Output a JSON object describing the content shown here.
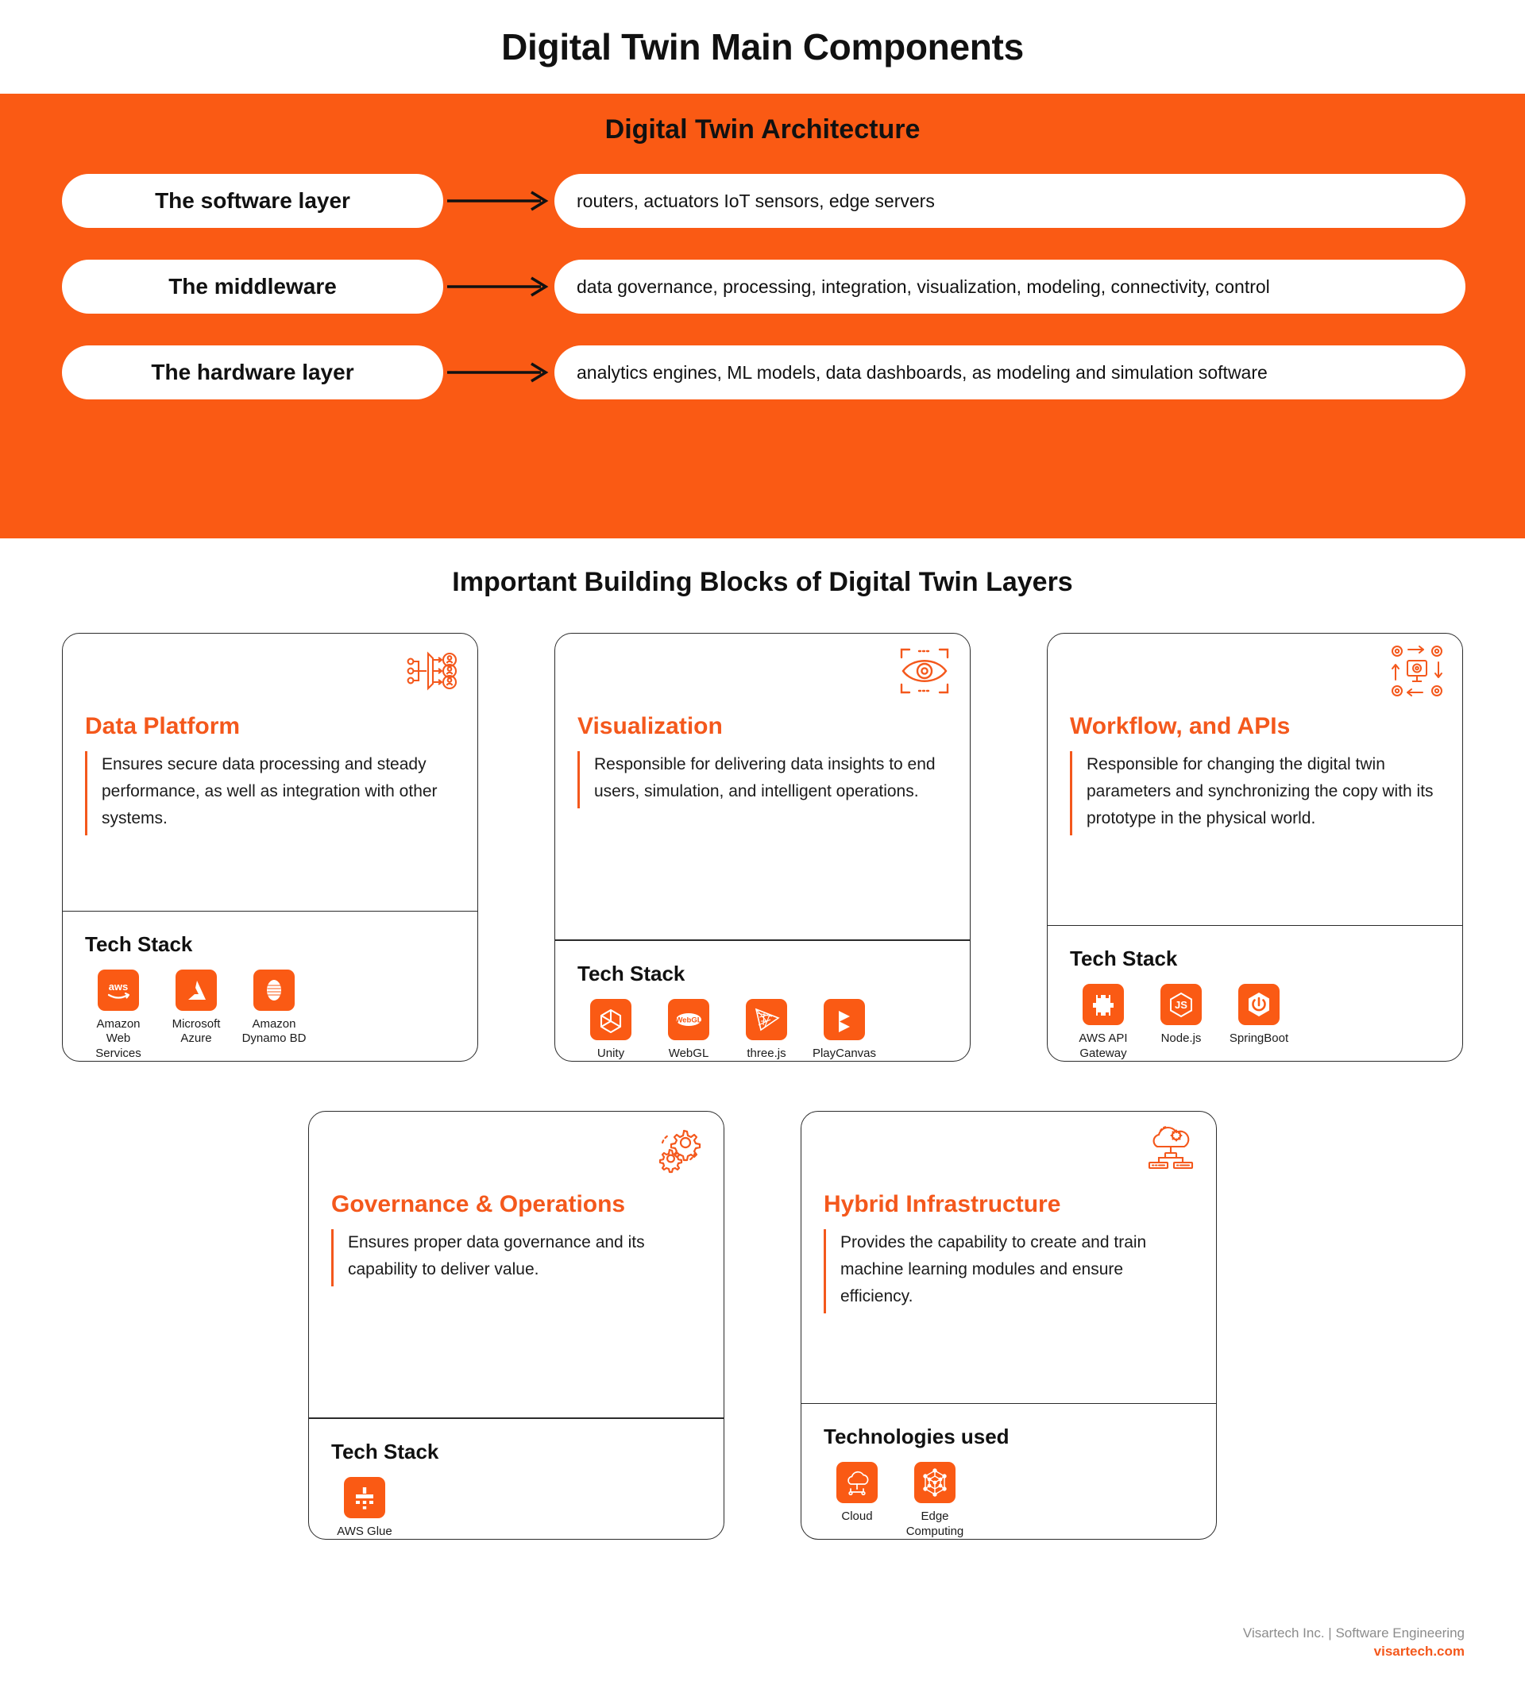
{
  "page_title": "Digital Twin Main Components",
  "architecture": {
    "title": "Digital Twin Architecture",
    "accent_color": "#FA5A14",
    "rows": [
      {
        "layer": "The software layer",
        "details": "routers, actuators IoT sensors, edge servers"
      },
      {
        "layer": "The middleware",
        "details": "data governance, processing, integration, visualization, modeling, connectivity, control"
      },
      {
        "layer": "The hardware layer",
        "details": "analytics engines, ML models, data dashboards, as modeling and simulation software"
      }
    ]
  },
  "blocks": {
    "title": "Important Building Blocks of Digital Twin Layers",
    "heading_color": "#F4581C",
    "cards": [
      {
        "icon": "data-distribution-icon",
        "heading": "Data Platform",
        "description": "Ensures secure data processing and steady performance, as well as integration with other systems.",
        "stack_title": "Tech Stack",
        "stack": [
          {
            "icon": "aws-icon",
            "label": "Amazon\nWeb Services"
          },
          {
            "icon": "azure-icon",
            "label": "Microsoft\nAzure"
          },
          {
            "icon": "dynamodb-icon",
            "label": "Amazon\nDynamo BD"
          }
        ]
      },
      {
        "icon": "eye-scan-icon",
        "heading": "Visualization",
        "description": "Responsible for delivering data insights to end users, simulation, and intelligent operations.",
        "stack_title": "Tech Stack",
        "stack": [
          {
            "icon": "unity-icon",
            "label": "Unity"
          },
          {
            "icon": "webgl-icon",
            "label": "WebGL"
          },
          {
            "icon": "threejs-icon",
            "label": "three.js"
          },
          {
            "icon": "playcanvas-icon",
            "label": "PlayCanvas"
          }
        ]
      },
      {
        "icon": "workflow-gears-icon",
        "heading": "Workflow, and APIs",
        "description": "Responsible for changing the digital twin parameters and synchronizing the copy with its prototype in the physical world.",
        "stack_title": "Tech Stack",
        "stack": [
          {
            "icon": "aws-api-gateway-icon",
            "label": "AWS API\nGateway"
          },
          {
            "icon": "nodejs-icon",
            "label": "Node.js"
          },
          {
            "icon": "springboot-icon",
            "label": "SpringBoot"
          }
        ]
      },
      {
        "icon": "gears-icon",
        "heading": "Governance & Operations",
        "description": "Ensures proper data governance and its capability to deliver value.",
        "stack_title": "Tech Stack",
        "stack": [
          {
            "icon": "aws-glue-icon",
            "label": "AWS Glue"
          }
        ]
      },
      {
        "icon": "cloud-server-icon",
        "heading": "Hybrid Infrastructure",
        "description": "Provides the capability to create and train machine learning modules and ensure efficiency.",
        "stack_title": "Technologies used",
        "stack": [
          {
            "icon": "cloud-icon",
            "label": "Cloud"
          },
          {
            "icon": "edge-computing-icon",
            "label": "Edge\nComputing"
          }
        ]
      }
    ]
  },
  "footer": {
    "company": "Visartech Inc. | Software Engineering",
    "url": "visartech.com"
  }
}
